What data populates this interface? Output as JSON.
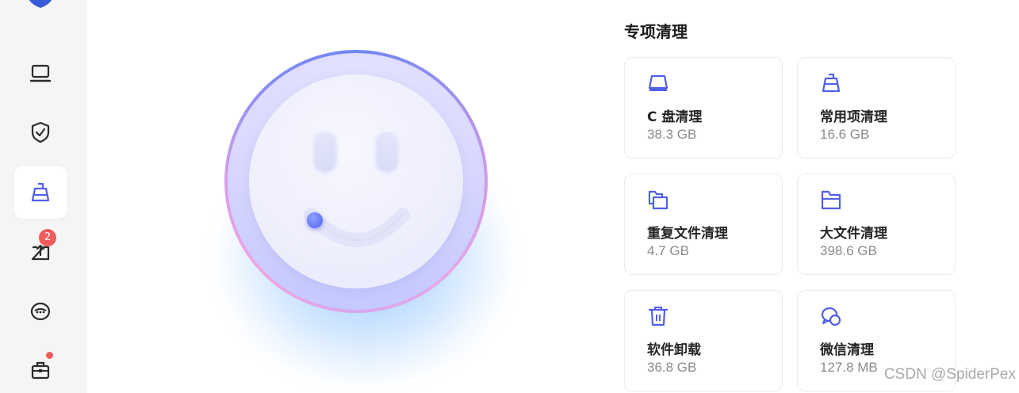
{
  "sidebar": {
    "items": [
      {
        "icon": "laptop-icon",
        "active": false
      },
      {
        "icon": "shield-check-icon",
        "active": false
      },
      {
        "icon": "broom-icon",
        "active": true
      },
      {
        "icon": "upload-drive-icon",
        "active": false,
        "badge": "2"
      },
      {
        "icon": "chat-bubble-icon",
        "active": false
      },
      {
        "icon": "toolbox-icon",
        "active": false,
        "dot": true
      }
    ]
  },
  "section": {
    "title": "专项清理"
  },
  "cards": [
    {
      "icon": "disk-icon",
      "title": "C 盘清理",
      "size": "38.3 GB"
    },
    {
      "icon": "broom-icon",
      "title": "常用项清理",
      "size": "16.6 GB"
    },
    {
      "icon": "duplicate-folder-icon",
      "title": "重复文件清理",
      "size": "4.7 GB"
    },
    {
      "icon": "folder-icon",
      "title": "大文件清理",
      "size": "398.6 GB"
    },
    {
      "icon": "trash-icon",
      "title": "软件卸载",
      "size": "36.8 GB"
    },
    {
      "icon": "wechat-icon",
      "title": "微信清理",
      "size": "127.8 MB"
    }
  ],
  "watermark": "CSDN @SpiderPex",
  "colors": {
    "accent": "#4f5fe8",
    "badge": "#f25b5b",
    "sidebar_bg": "#f5f5f6"
  }
}
